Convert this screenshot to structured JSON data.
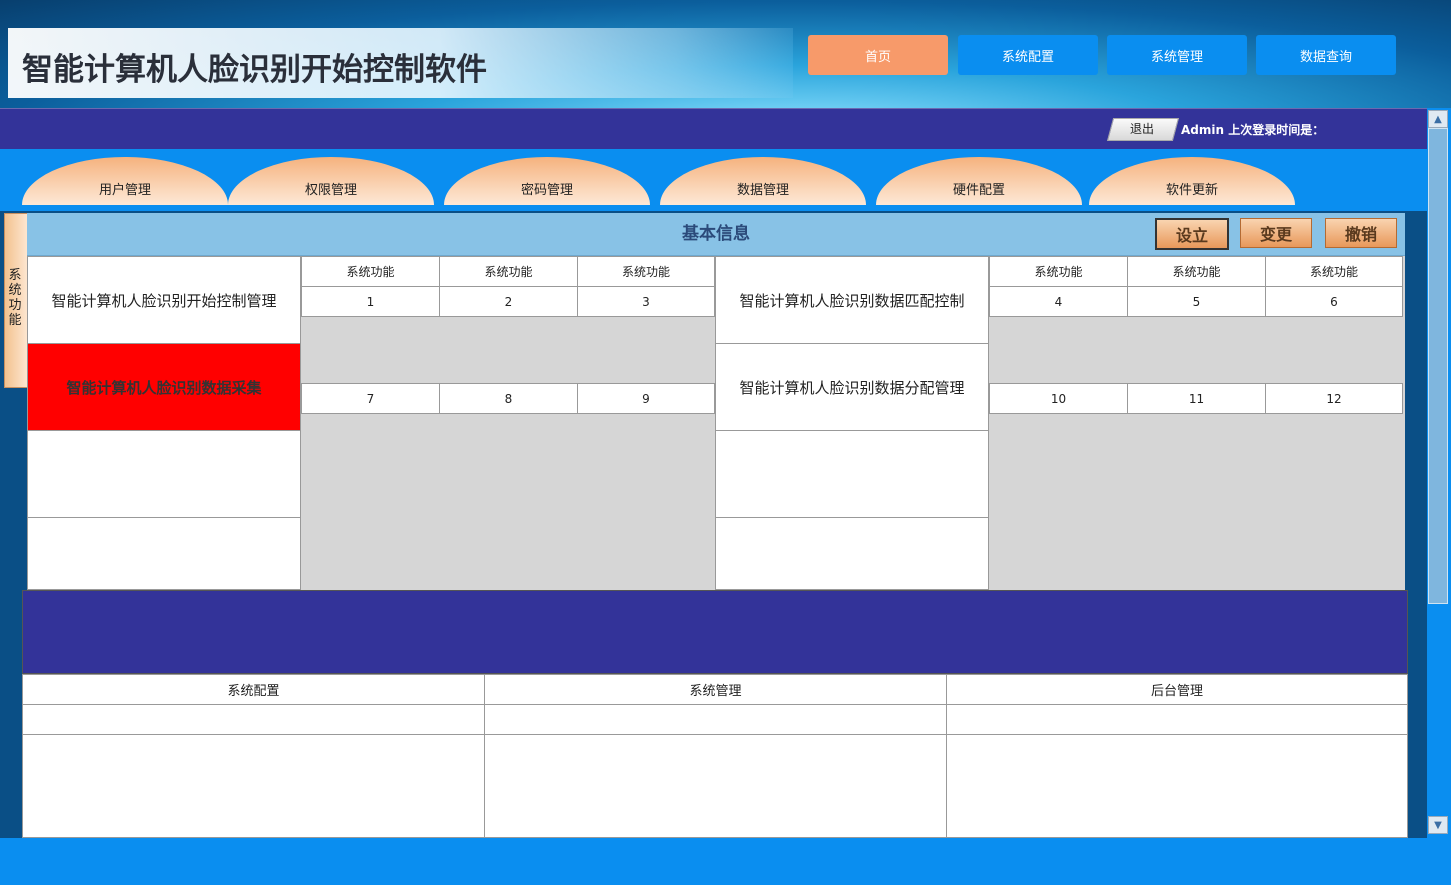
{
  "header": {
    "title": "智能计算机人脸识别开始控制软件",
    "nav": [
      "首页",
      "系统配置",
      "系统管理",
      "数据查询"
    ]
  },
  "userbar": {
    "logout": "退出",
    "info": "Admin  上次登录时间是："
  },
  "tabs": [
    "用户管理",
    "权限管理",
    "密码管理",
    "数据管理",
    "硬件配置",
    "软件更新"
  ],
  "side_label": "系统功能",
  "panel": {
    "title": "基本信息",
    "actions": [
      "设立",
      "变更",
      "撤销"
    ],
    "left_modules": [
      "智能计算机人脸识别开始控制管理",
      "智能计算机人脸识别数据采集",
      "",
      ""
    ],
    "right_modules": [
      "智能计算机人脸识别数据匹配控制",
      "智能计算机人脸识别数据分配管理",
      "",
      ""
    ],
    "func_header": "系统功能",
    "numbers": [
      "1",
      "2",
      "3",
      "4",
      "5",
      "6",
      "7",
      "8",
      "9",
      "10",
      "11",
      "12"
    ]
  },
  "bottom_table": {
    "headers": [
      "系统配置",
      "系统管理",
      "后台管理"
    ]
  },
  "colors": {
    "navy": "#333399",
    "blue": "#0a8ef0",
    "accent_orange": "#f79a6a",
    "highlight_red": "#ff0000"
  }
}
